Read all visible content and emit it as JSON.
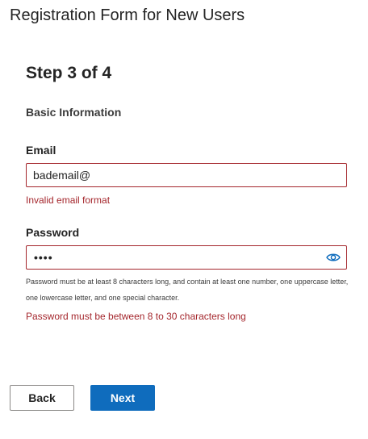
{
  "page": {
    "title": "Registration Form for New Users"
  },
  "form": {
    "step_title": "Step 3 of 4",
    "section_label": "Basic Information",
    "email": {
      "label": "Email",
      "value": "bademail@",
      "error": "Invalid email format"
    },
    "password": {
      "label": "Password",
      "masked_value": "••••",
      "hint": "Password must be at least 8 characters long, and contain at least one number, one uppercase letter, one lowercase letter, and one special character.",
      "error": "Password must be between 8 to 30 characters long",
      "reveal_icon": "eye-icon"
    }
  },
  "buttons": {
    "back_label": "Back",
    "next_label": "Next"
  },
  "colors": {
    "error": "#a4262c",
    "primary": "#0f6cbd",
    "text": "#242424"
  }
}
